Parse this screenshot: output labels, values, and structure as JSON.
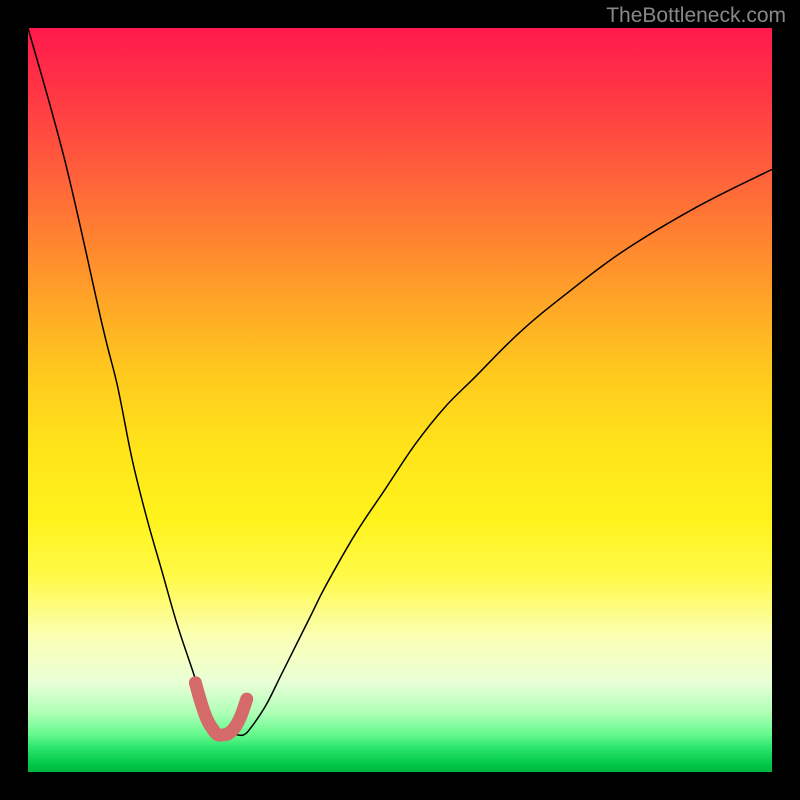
{
  "watermark": "TheBottleneck.com",
  "chart_data": {
    "type": "line",
    "title": "",
    "xlabel": "",
    "ylabel": "",
    "xlim": [
      0,
      100
    ],
    "ylim": [
      0,
      100
    ],
    "grid": false,
    "legend": false,
    "x": [
      0,
      5,
      10,
      12,
      14,
      16,
      18,
      20,
      22,
      23,
      24,
      25,
      26,
      27,
      28,
      29,
      30,
      32,
      34,
      36,
      38,
      40,
      44,
      48,
      52,
      56,
      60,
      66,
      72,
      80,
      90,
      100
    ],
    "series": [
      {
        "name": "bottleneck-curve",
        "values": [
          100,
          82,
          60,
          52,
          42,
          34,
          27,
          20,
          14,
          11,
          8,
          6,
          5,
          5,
          5,
          5,
          6,
          9,
          13,
          17,
          21,
          25,
          32,
          38,
          44,
          49,
          53,
          59,
          64,
          70,
          76,
          81
        ]
      }
    ],
    "highlight": {
      "name": "optimal-range",
      "x": [
        22.5,
        23.2,
        24,
        24.8,
        25.5,
        26.3,
        27,
        27.8,
        28.6,
        29.4
      ],
      "values": [
        12,
        9.5,
        7.2,
        5.8,
        5,
        5,
        5.2,
        6,
        7.5,
        9.8
      ]
    }
  }
}
